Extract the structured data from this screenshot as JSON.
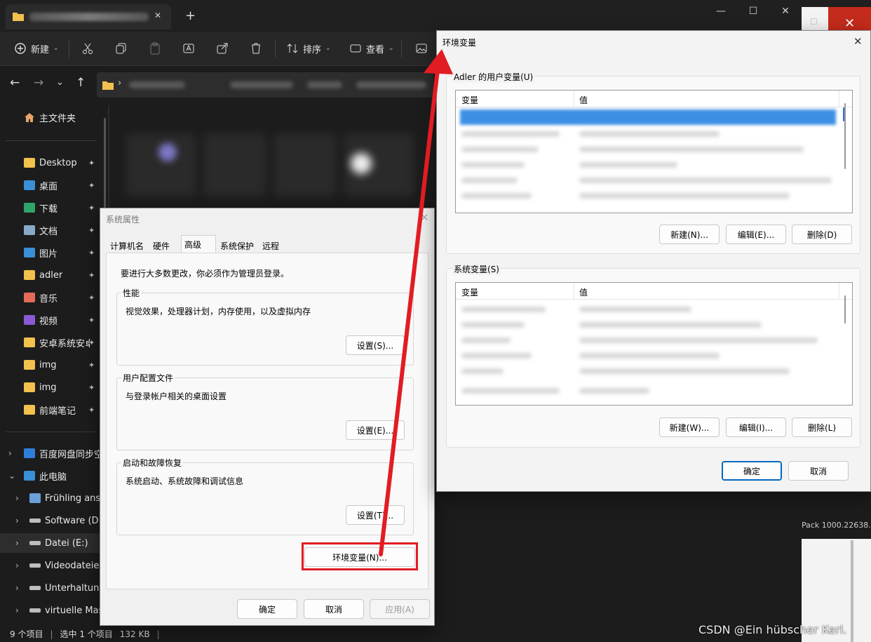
{
  "explorer": {
    "toolbar": {
      "new_label": "新建",
      "sort_label": "排序",
      "view_label": "查看"
    },
    "window_controls": {
      "minimize": "—",
      "maximize": "☐",
      "close": "✕",
      "new_tab": "+"
    },
    "nav": {
      "back": "←",
      "forward": "→",
      "recent": "⌄",
      "up": "↑",
      "path_sep": "›"
    },
    "sidebar": {
      "home": "主文件夹",
      "pinned": [
        {
          "label": "Desktop",
          "icon": "folder-icon"
        },
        {
          "label": "桌面",
          "icon": "desktop-icon"
        },
        {
          "label": "下载",
          "icon": "download-icon"
        },
        {
          "label": "文档",
          "icon": "document-icon"
        },
        {
          "label": "图片",
          "icon": "picture-icon"
        },
        {
          "label": "adler",
          "icon": "folder-icon"
        },
        {
          "label": "音乐",
          "icon": "music-icon"
        },
        {
          "label": "视频",
          "icon": "video-icon"
        },
        {
          "label": "安卓系统安卓",
          "icon": "folder-icon"
        },
        {
          "label": "img",
          "icon": "folder-icon"
        },
        {
          "label": "img",
          "icon": "folder-icon"
        },
        {
          "label": "前端笔记",
          "icon": "folder-icon"
        }
      ],
      "tree": [
        {
          "label": "百度网盘同步空",
          "icon": "cloud-icon"
        },
        {
          "label": "此电脑",
          "icon": "pc-icon"
        },
        {
          "label": "Frühling anse",
          "icon": "network-icon"
        },
        {
          "label": "Software (D:)",
          "icon": "drive-icon"
        },
        {
          "label": "Datei (E:)",
          "icon": "drive-icon"
        },
        {
          "label": "Videodateien",
          "icon": "drive-icon"
        },
        {
          "label": "Unterhaltung",
          "icon": "drive-icon"
        },
        {
          "label": "virtuelle Masc",
          "icon": "drive-icon"
        }
      ]
    },
    "status": {
      "items": "9 个项目",
      "selected": "选中 1 个项目",
      "size": "132 KB"
    }
  },
  "background_window": {
    "text": "Pack 1000.22638."
  },
  "system_properties": {
    "title": "系统属性",
    "close": "✕",
    "tabs": [
      "计算机名",
      "硬件",
      "高级",
      "系统保护",
      "远程"
    ],
    "active_tab": "高级",
    "admin_note": "要进行大多数更改，你必须作为管理员登录。",
    "performance": {
      "label": "性能",
      "desc": "视觉效果，处理器计划，内存使用，以及虚拟内存",
      "button": "设置(S)..."
    },
    "user_profiles": {
      "label": "用户配置文件",
      "desc": "与登录帐户相关的桌面设置",
      "button": "设置(E)..."
    },
    "startup": {
      "label": "启动和故障恢复",
      "desc": "系统启动、系统故障和调试信息",
      "button": "设置(T)..."
    },
    "env_button": "环境变量(N)...",
    "ok": "确定",
    "cancel": "取消",
    "apply": "应用(A)"
  },
  "env_vars": {
    "title": "环境变量",
    "close": "✕",
    "user_section": "Adler 的用户变量(U)",
    "system_section": "系统变量(S)",
    "col_variable": "变量",
    "col_value": "值",
    "user_buttons": {
      "new": "新建(N)...",
      "edit": "编辑(E)...",
      "delete": "删除(D)"
    },
    "system_buttons": {
      "new": "新建(W)...",
      "edit": "编辑(I)...",
      "delete": "删除(L)"
    },
    "ok": "确定",
    "cancel": "取消"
  },
  "watermark": "CSDN @Ein hübscher Kerl.",
  "colors": {
    "annotation_red": "#e21c23",
    "accent": "#0067c0",
    "folder": "#f2c14e"
  }
}
